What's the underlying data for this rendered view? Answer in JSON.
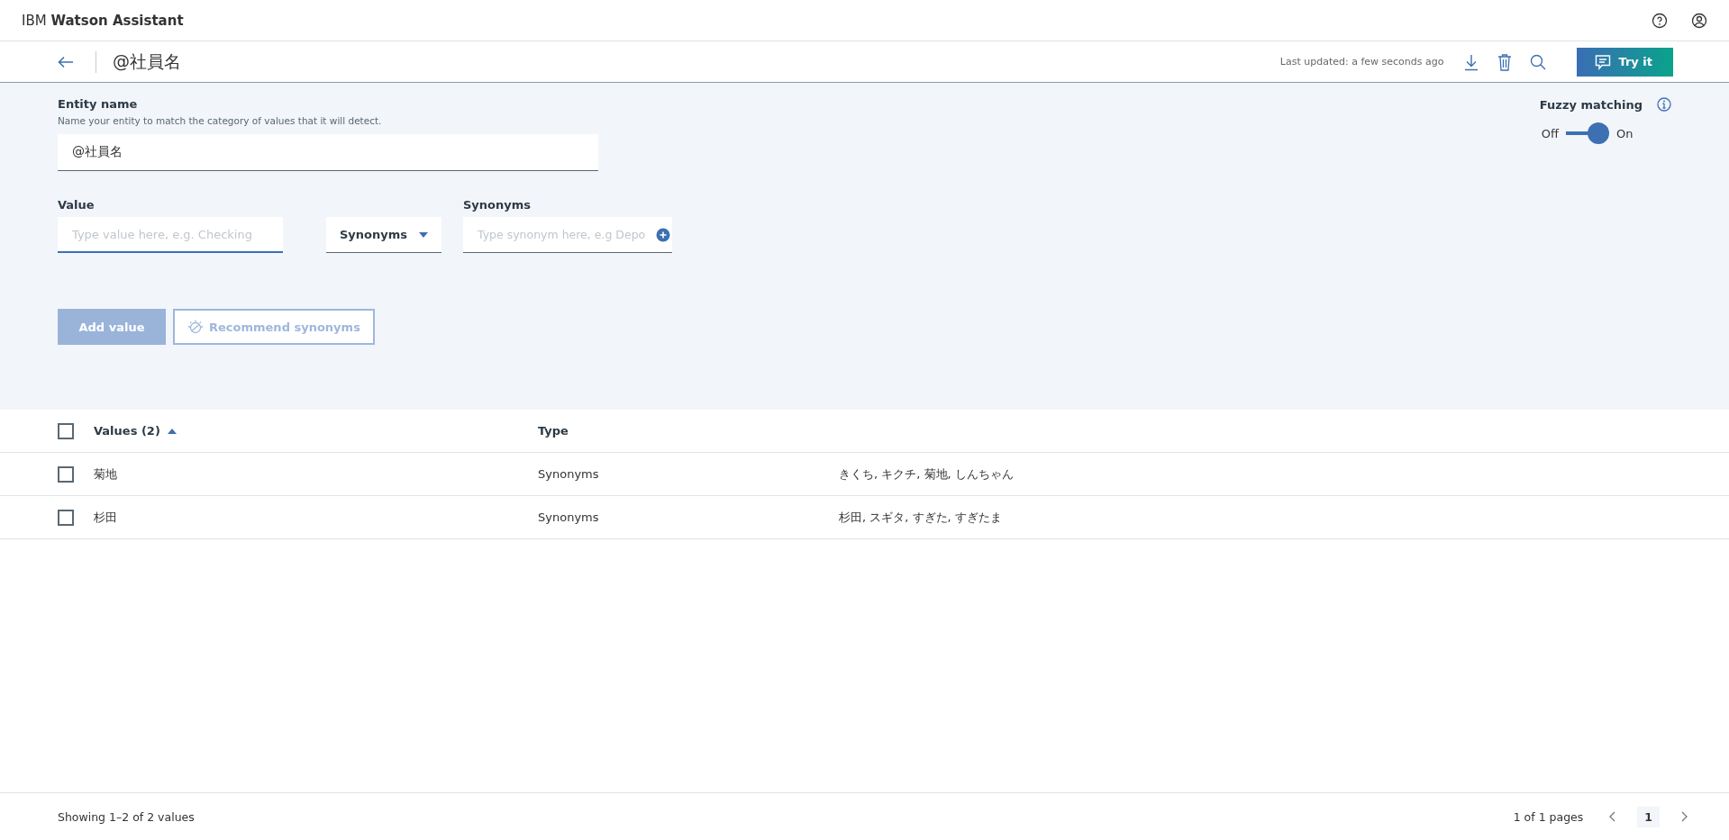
{
  "header": {
    "brand_prefix": "IBM",
    "brand_name": "Watson Assistant"
  },
  "toolbar": {
    "title": "@社員名",
    "last_updated": "Last updated: a few seconds ago",
    "try_button": "Try it"
  },
  "entity": {
    "label": "Entity name",
    "hint": "Name your entity to match the category of values that it will detect.",
    "value": "@社員名"
  },
  "fuzzy": {
    "label": "Fuzzy matching",
    "off_label": "Off",
    "on_label": "On",
    "on": true
  },
  "value_form": {
    "value_label": "Value",
    "value_placeholder": "Type value here, e.g. Checking",
    "type_dropdown": "Synonyms",
    "synonyms_label": "Synonyms",
    "synonyms_placeholder": "Type synonym here, e.g Depo",
    "add_button": "Add value",
    "add_disabled": true,
    "recommend_button": "Recommend synonyms",
    "recommend_disabled": true
  },
  "table": {
    "columns": [
      "Values (2)",
      "Type"
    ],
    "all_checked": false,
    "rows": [
      {
        "value": "菊地",
        "type": "Synonyms",
        "synonyms": "きくち, キクチ, 菊地, しんちゃん",
        "checked": false
      },
      {
        "value": "杉田",
        "type": "Synonyms",
        "synonyms": "杉田, スギタ, すぎた, すぎたま",
        "checked": false
      }
    ]
  },
  "footer": {
    "showing": "Showing 1–2 of 2 values",
    "pages": "1 of 1 pages",
    "current_page": "1"
  }
}
